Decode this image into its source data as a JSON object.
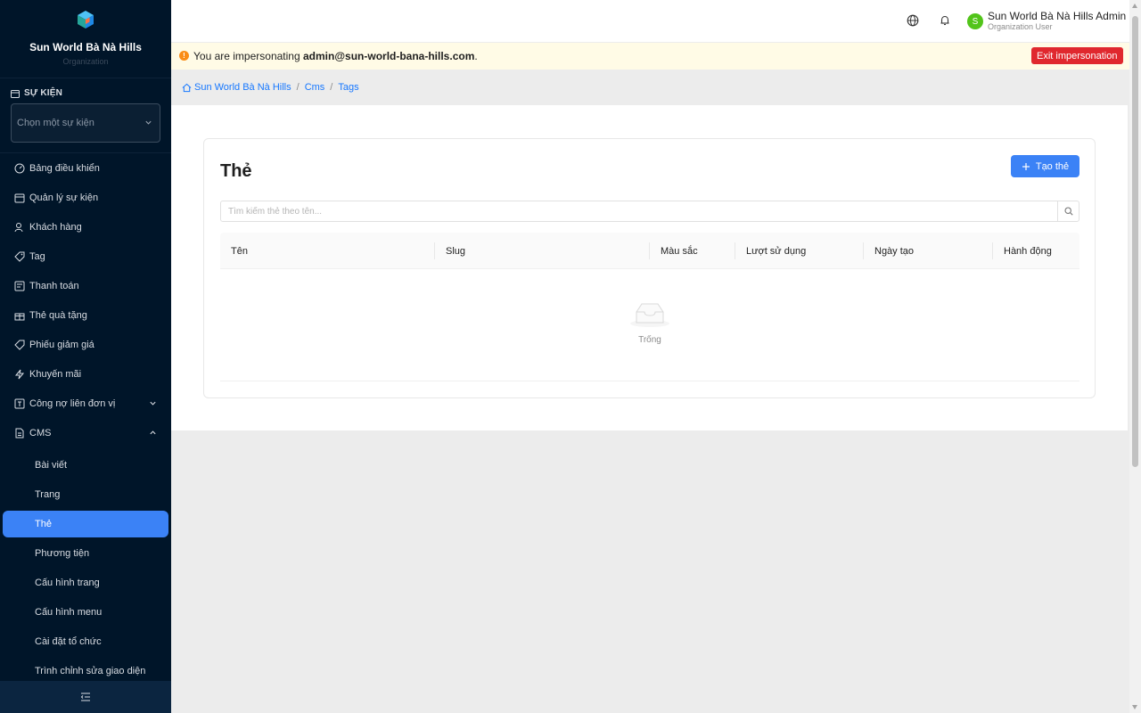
{
  "brand": {
    "name": "Sun World Bà Nà Hills",
    "subtitle": "Organization"
  },
  "event": {
    "label": "SỰ KIỆN",
    "placeholder": "Chọn một sự kiện"
  },
  "menu": {
    "dashboard": "Bảng điều khiển",
    "events": "Quản lý sự kiện",
    "customers": "Khách hàng",
    "tag": "Tag",
    "payments": "Thanh toán",
    "gift_cards": "Thẻ quà tặng",
    "coupons": "Phiếu giảm giá",
    "promotions": "Khuyến mãi",
    "inter_unit_debt": "Công nợ liên đơn vị",
    "cms": "CMS",
    "cms_items": {
      "posts": "Bài viết",
      "pages": "Trang",
      "tags": "Thẻ",
      "media": "Phương tiện",
      "page_config": "Cấu hình trang",
      "menu_config": "Cấu hình menu",
      "org_settings": "Cài đặt tổ chức",
      "theme_editor": "Trình chỉnh sửa giao diện"
    }
  },
  "header": {
    "user_initial": "S",
    "user_name": "Sun World Bà Nà Hills Admin",
    "user_role": "Organization User"
  },
  "banner": {
    "prefix": "You are impersonating ",
    "email": "admin@sun-world-bana-hills.com",
    "suffix": ".",
    "exit_label": "Exit impersonation"
  },
  "breadcrumb": {
    "home": "Sun World Bà Nà Hills",
    "section": "Cms",
    "current": "Tags"
  },
  "page": {
    "title": "Thẻ",
    "create_label": "Tạo thẻ",
    "search_placeholder": "Tìm kiếm thẻ theo tên...",
    "columns": {
      "name": "Tên",
      "slug": "Slug",
      "color": "Màu sắc",
      "usage": "Lượt sử dụng",
      "created": "Ngày tạo",
      "actions": "Hành động"
    },
    "empty_text": "Trống"
  },
  "colors": {
    "sidebar_bg": "#001529",
    "primary": "#3b82f6",
    "danger": "#e0282e",
    "banner_bg": "#fffbe6",
    "avatar": "#52c41a"
  }
}
